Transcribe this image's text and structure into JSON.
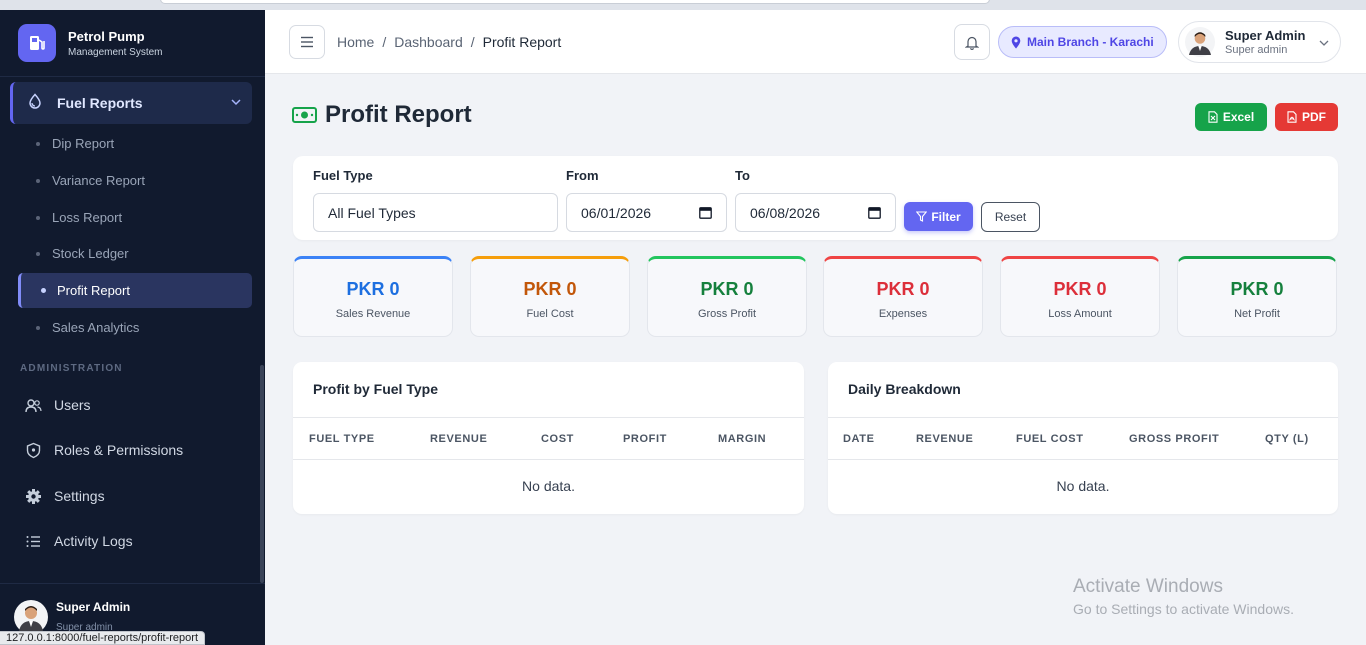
{
  "brand": {
    "title": "Petrol Pump",
    "subtitle": "Management System"
  },
  "sidebar": {
    "parent": "Fuel Reports",
    "sub_items": [
      "Dip Report",
      "Variance Report",
      "Loss Report",
      "Stock Ledger",
      "Profit Report",
      "Sales Analytics"
    ],
    "section_label": "ADMINISTRATION",
    "admin_items": [
      "Users",
      "Roles & Permissions",
      "Settings",
      "Activity Logs"
    ],
    "user": {
      "name": "Super Admin",
      "role": "Super admin"
    }
  },
  "status_url": "127.0.0.1:8000/fuel-reports/profit-report",
  "header": {
    "breadcrumb": [
      "Home",
      "Dashboard",
      "Profit Report"
    ],
    "branch": "Main Branch - Karachi",
    "user": {
      "name": "Super Admin",
      "role": "Super admin"
    }
  },
  "page": {
    "title": "Profit Report",
    "excel_label": "Excel",
    "pdf_label": "PDF"
  },
  "filters": {
    "fuel_type_label": "Fuel Type",
    "fuel_type_value": "All Fuel Types",
    "from_label": "From",
    "from_value": "06/01/2026",
    "to_label": "To",
    "to_value": "06/08/2026",
    "filter_label": "Filter",
    "reset_label": "Reset"
  },
  "stats": [
    {
      "value": "PKR 0",
      "label": "Sales Revenue",
      "color": "#1d6fe0"
    },
    {
      "value": "PKR 0",
      "label": "Fuel Cost",
      "color": "#c2570a"
    },
    {
      "value": "PKR 0",
      "label": "Gross Profit",
      "color": "#15803d"
    },
    {
      "value": "PKR 0",
      "label": "Expenses",
      "color": "#dc2f3a"
    },
    {
      "value": "PKR 0",
      "label": "Loss Amount",
      "color": "#dc2f3a"
    },
    {
      "value": "PKR 0",
      "label": "Net Profit",
      "color": "#15803d"
    }
  ],
  "table_fuel": {
    "title": "Profit by Fuel Type",
    "columns": [
      "FUEL TYPE",
      "REVENUE",
      "COST",
      "PROFIT",
      "MARGIN"
    ],
    "empty": "No data."
  },
  "table_daily": {
    "title": "Daily Breakdown",
    "columns": [
      "DATE",
      "REVENUE",
      "FUEL COST",
      "GROSS PROFIT",
      "QTY (L)"
    ],
    "empty": "No data."
  },
  "watermark": {
    "line1": "Activate Windows",
    "line2": "Go to Settings to activate Windows."
  }
}
